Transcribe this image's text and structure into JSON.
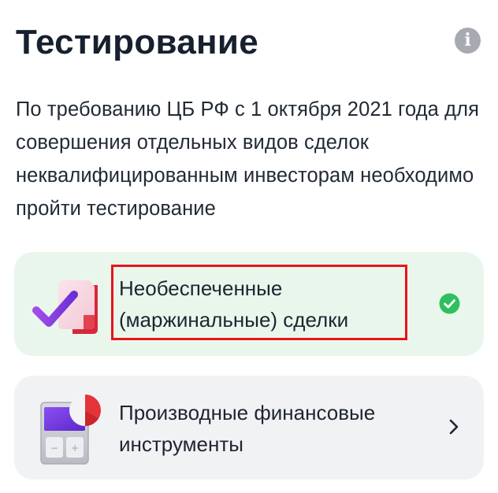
{
  "header": {
    "title": "Тестирование",
    "info_icon": "info-icon",
    "info_glyph": "i"
  },
  "description": "По требованию ЦБ РФ с 1 октября 2021 года для совершения отдельных видов сделок неквалифицированным инвесторам необходимо пройти тестирование",
  "tests": [
    {
      "label": "Необеспеченные (маржинальные) сделки",
      "status": "passed",
      "status_icon": "check-circle-icon",
      "illustration": "document-check-icon",
      "background": "#e9f6ec",
      "highlighted": true
    },
    {
      "label": "Производные финансовые инструменты",
      "status": "not-passed",
      "status_icon": "chevron-right-icon",
      "illustration": "calculator-pie-icon",
      "background": "#f1f2f4",
      "highlighted": false
    }
  ],
  "colors": {
    "accent_green": "#2fbf5f",
    "highlight_red": "#e8141a",
    "pie_red": "#e5333a",
    "screen_purple": "#7c3ff0"
  }
}
